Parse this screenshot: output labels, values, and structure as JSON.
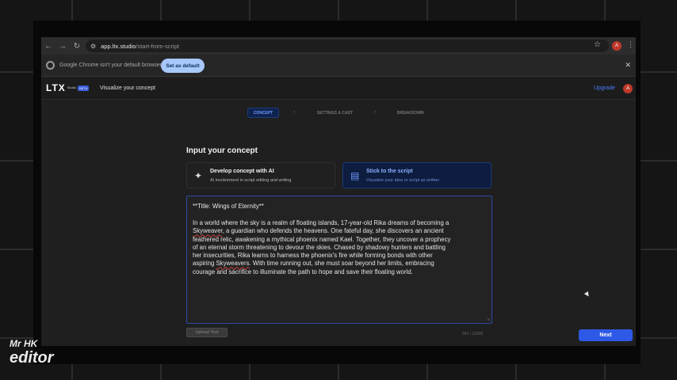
{
  "browser": {
    "url_host": "app.ltx.studio",
    "url_path": "/start-from-script",
    "profile_initial": "A"
  },
  "infobar": {
    "message": "Google Chrome isn't your default browser",
    "set_default_label": "Set as default"
  },
  "app": {
    "logo_text": "LTX",
    "logo_sub": "Studio",
    "beta_label": "BETA",
    "tagline": "Visualize your concept",
    "upgrade_label": "Upgrade",
    "avatar_initial": "A"
  },
  "steps": [
    {
      "label": "CONCEPT",
      "active": true
    },
    {
      "label": "SETTINGS & CAST",
      "active": false
    },
    {
      "label": "BREAKDOWN",
      "active": false
    }
  ],
  "content": {
    "title": "Input your concept",
    "options": [
      {
        "title": "Develop concept with AI",
        "subtitle": "AI involvement in script editing and writing",
        "selected": false,
        "icon": "magic-wand-icon"
      },
      {
        "title": "Stick to the script",
        "subtitle": "Visualize your idea or script as written",
        "selected": true,
        "icon": "document-icon"
      }
    ],
    "script_title": "**Title: Wings of Eternity**",
    "script_lines": [
      "In a world where the sky is a realm of floating islands, 17-year-old Rika dreams of becoming a",
      "Skyweaver",
      ", a guardian who defends the heavens. One fateful day, she discovers an ancient",
      "feathered relic, awakening a mythical phoenix named Kael. Together, they uncover a prophecy",
      "of an eternal storm threatening to devour the skies. Chased by shadowy hunters and battling",
      "her insecurities, Rika learns to harness the phoenix's fire while forming bonds with other",
      "aspiring ",
      "Skyweavers",
      ". With time running out, she must soar beyond her limits, embracing",
      "courage and sacrifice to illuminate the path to hope and save their floating world."
    ],
    "upload_label": "Upload Text",
    "char_count": "661 / 12000",
    "next_label": "Next"
  },
  "watermark": {
    "line1": "Mr HK",
    "line2": "editor"
  },
  "colors": {
    "accent": "#2d59e6",
    "active_step": "#0f2350",
    "selected_card": "#0d1c3f"
  }
}
